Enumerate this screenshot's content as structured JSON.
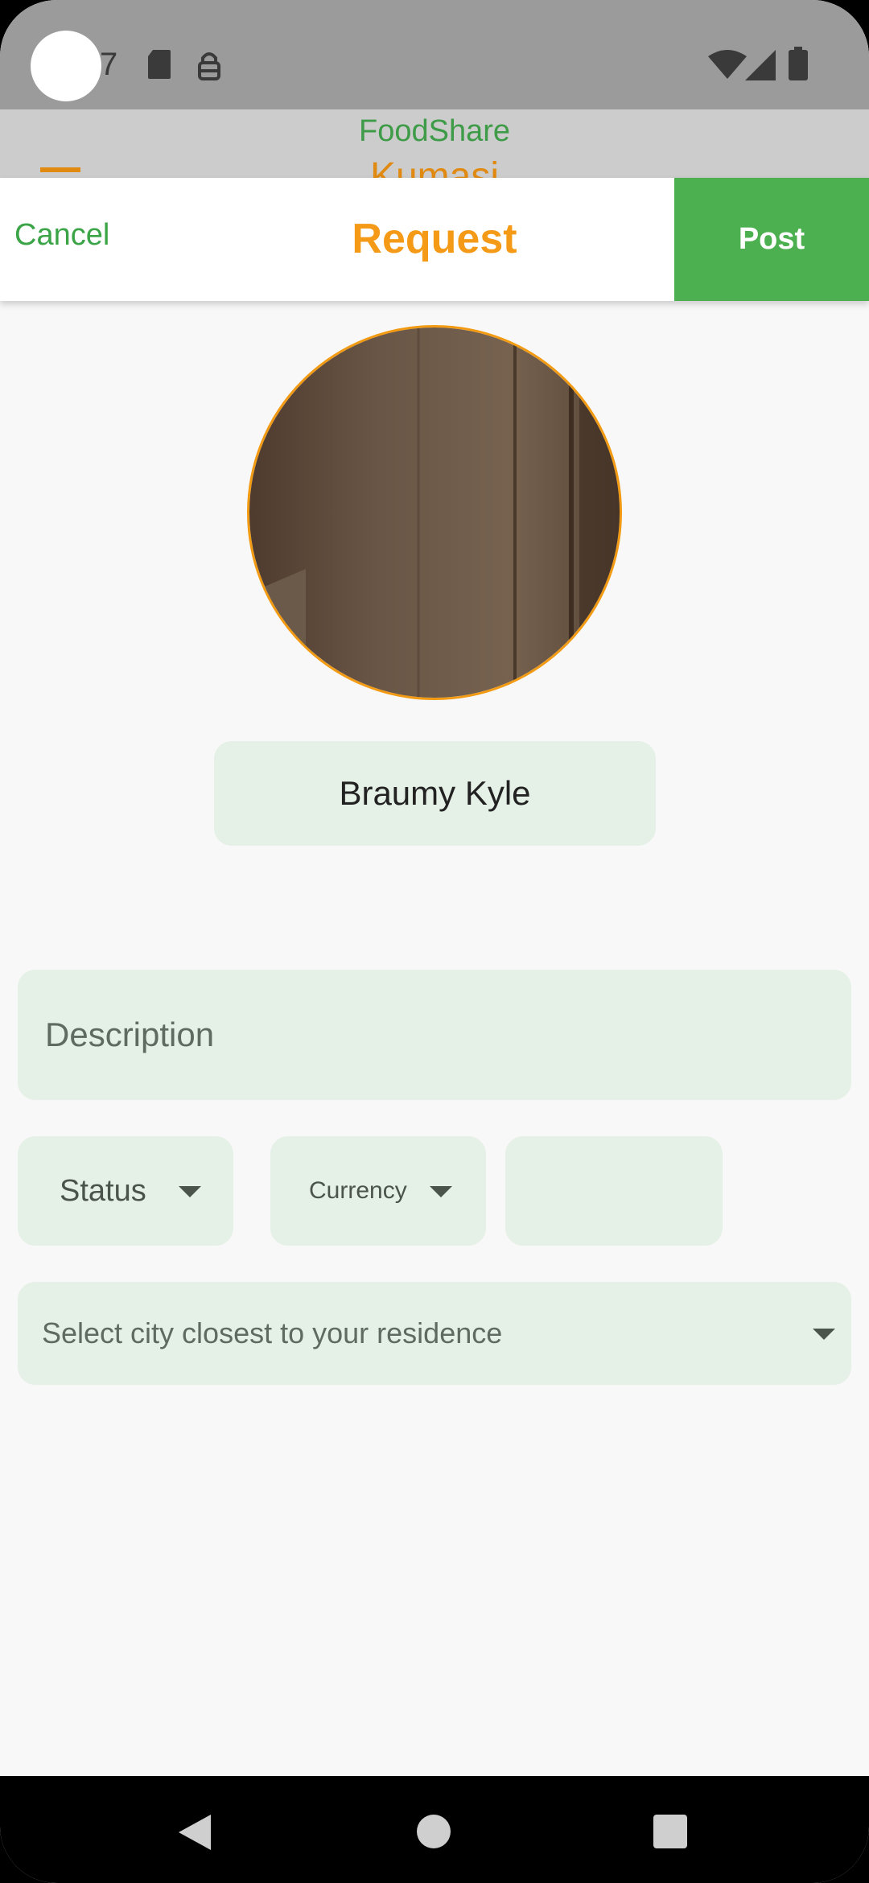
{
  "status_bar": {
    "time_fragment": "7",
    "icons": [
      "sd-card-icon",
      "vpn-key-icon",
      "wifi-icon",
      "signal-icon",
      "battery-icon"
    ]
  },
  "app_bar": {
    "title": "FoodShare",
    "city": "Kumasi",
    "menu_icon": "menu-icon"
  },
  "sheet": {
    "cancel_label": "Cancel",
    "title": "Request",
    "post_label": "Post"
  },
  "profile": {
    "name": "Braumy Kyle"
  },
  "form": {
    "description_placeholder": "Description",
    "status_label": "Status",
    "currency_label": "Currency",
    "amount_value": "",
    "city_placeholder": "Select city closest to your residence"
  },
  "colors": {
    "accent_orange": "#F49A17",
    "accent_green": "#4CAF50",
    "field_bg": "#E5F0E6"
  },
  "nav_bar": {
    "icons": [
      "back-icon",
      "home-icon",
      "recents-icon"
    ]
  }
}
